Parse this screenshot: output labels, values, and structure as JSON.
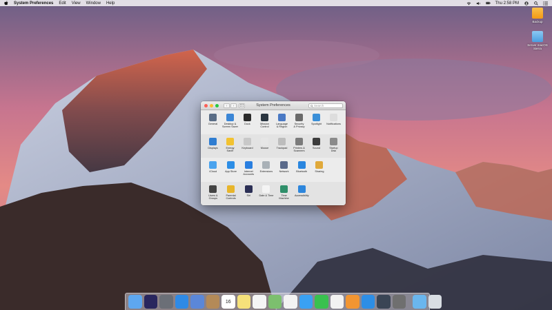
{
  "menubar": {
    "app_name": "System Preferences",
    "menus": [
      "Edit",
      "View",
      "Window",
      "Help"
    ],
    "clock": "Thu 2:58 PM"
  },
  "desktop": {
    "icons": [
      {
        "label": "Backup",
        "icon": "orange-folder-icon",
        "color": "#f7a81b"
      },
      {
        "label": "Server macOS Sierra",
        "icon": "blue-folder-icon",
        "color": "#5aaee8"
      }
    ]
  },
  "window": {
    "title": "System Preferences",
    "search_placeholder": "Search",
    "rows": [
      [
        {
          "label": "General",
          "icon": "general-icon",
          "color": "#5a6d86"
        },
        {
          "label": "Desktop &\nScreen Saver",
          "icon": "desktop-screensaver-icon",
          "color": "#3b86d6"
        },
        {
          "label": "Dock",
          "icon": "dock-icon",
          "color": "#2b2b2b"
        },
        {
          "label": "Mission\nControl",
          "icon": "mission-control-icon",
          "color": "#2a3540"
        },
        {
          "label": "Language\n& Region",
          "icon": "language-region-icon",
          "color": "#4a79c4"
        },
        {
          "label": "Security\n& Privacy",
          "icon": "security-privacy-icon",
          "color": "#6a6a6a"
        },
        {
          "label": "Spotlight",
          "icon": "spotlight-icon",
          "color": "#3a8fd8"
        },
        {
          "label": "Notifications",
          "icon": "notifications-icon",
          "color": "#dddddd"
        }
      ],
      [
        {
          "label": "Displays",
          "icon": "displays-icon",
          "color": "#2f7dd1"
        },
        {
          "label": "Energy\nSaver",
          "icon": "energy-saver-icon",
          "color": "#f2c230"
        },
        {
          "label": "Keyboard",
          "icon": "keyboard-icon",
          "color": "#c8c8c8"
        },
        {
          "label": "Mouse",
          "icon": "mouse-icon",
          "color": "#e6e6e6"
        },
        {
          "label": "Trackpad",
          "icon": "trackpad-icon",
          "color": "#bdbdbd"
        },
        {
          "label": "Printers &\nScanners",
          "icon": "printers-scanners-icon",
          "color": "#7b7b7b"
        },
        {
          "label": "Sound",
          "icon": "sound-icon",
          "color": "#3c3c3c"
        },
        {
          "label": "Startup\nDisk",
          "icon": "startup-disk-icon",
          "color": "#8a8a8a"
        }
      ],
      [
        {
          "label": "iCloud",
          "icon": "icloud-icon",
          "color": "#4aa3ee"
        },
        {
          "label": "App Store",
          "icon": "app-store-icon",
          "color": "#2d8ee6"
        },
        {
          "label": "Internet\nAccounts",
          "icon": "internet-accounts-icon",
          "color": "#2a7fe0"
        },
        {
          "label": "Extensions",
          "icon": "extensions-icon",
          "color": "#a9b1b7"
        },
        {
          "label": "Network",
          "icon": "network-icon",
          "color": "#5a6a8a"
        },
        {
          "label": "Bluetooth",
          "icon": "bluetooth-icon",
          "color": "#2a86df"
        },
        {
          "label": "Sharing",
          "icon": "sharing-icon",
          "color": "#e0a93a"
        }
      ],
      [
        {
          "label": "Users &\nGroups",
          "icon": "users-groups-icon",
          "color": "#444444"
        },
        {
          "label": "Parental\nControls",
          "icon": "parental-controls-icon",
          "color": "#e7b52b"
        },
        {
          "label": "Siri",
          "icon": "siri-icon",
          "color": "#2b2f55"
        },
        {
          "label": "Date & Time",
          "icon": "date-time-icon",
          "color": "#f4f4f4"
        },
        {
          "label": "Time\nMachine",
          "icon": "time-machine-icon",
          "color": "#2f8f6a"
        },
        {
          "label": "Accessibility",
          "icon": "accessibility-icon",
          "color": "#2d86dc"
        }
      ]
    ]
  },
  "dock": {
    "items": [
      {
        "icon": "finder-icon",
        "color": "#5ea7f0"
      },
      {
        "icon": "siri-icon",
        "color": "#29265e"
      },
      {
        "icon": "launchpad-icon",
        "color": "#6b6f77"
      },
      {
        "icon": "safari-icon",
        "color": "#2f8ae6"
      },
      {
        "icon": "mail-icon",
        "color": "#5b87d8"
      },
      {
        "icon": "contacts-icon",
        "color": "#b48a58"
      },
      {
        "icon": "calendar-icon",
        "color": "#ffffff",
        "text": "16"
      },
      {
        "icon": "notes-icon",
        "color": "#f6e17a"
      },
      {
        "icon": "reminders-icon",
        "color": "#f5f5f5"
      },
      {
        "icon": "maps-icon",
        "color": "#7cbf6e"
      },
      {
        "icon": "photos-icon",
        "color": "#f3f3f3"
      },
      {
        "icon": "messages-icon",
        "color": "#3aa1f3"
      },
      {
        "icon": "facetime-icon",
        "color": "#39c14f"
      },
      {
        "icon": "itunes-icon",
        "color": "#f2f2f2"
      },
      {
        "icon": "ibooks-icon",
        "color": "#f29531"
      },
      {
        "icon": "app-store-icon",
        "color": "#2d8ee6"
      },
      {
        "icon": "quicktime-icon",
        "color": "#3a4555"
      },
      {
        "icon": "system-preferences-icon",
        "color": "#6f6f6f"
      },
      {
        "icon": "downloads-folder-icon",
        "color": "#6ab6ee"
      },
      {
        "icon": "trash-icon",
        "color": "#d8dde3"
      }
    ]
  }
}
